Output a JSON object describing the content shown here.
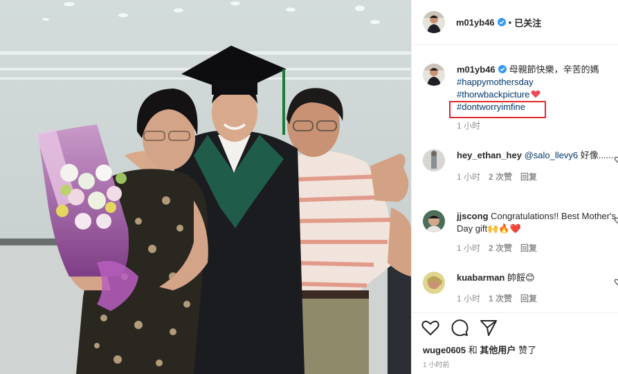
{
  "post": {
    "username": "m01yb46",
    "follow_label": "已关注",
    "dot": "•"
  },
  "caption": {
    "username": "m01yb46",
    "text": "母親節快樂，辛苦的媽",
    "hashtags": [
      "#happymothersday",
      "#thorwbackpicture",
      "#dontworryimfine"
    ],
    "time": "1 小时"
  },
  "comments": [
    {
      "username": "hey_ethan_hey",
      "text": "@salo_llevy6 好像......",
      "mention": "@salo_llevy6",
      "rest": " 好像......",
      "time": "1 小时",
      "likes": "2 次赞",
      "reply": "回复"
    },
    {
      "username": "jjscong",
      "text": "Congratulations!! Best Mother's Day gift🙌🔥❤️",
      "time": "1 小时",
      "likes": "2 次赞",
      "reply": "回复"
    },
    {
      "username": "kuabarman",
      "text": "帥餒😊",
      "time": "1 小时",
      "likes": "1 次赞",
      "reply": "回复"
    }
  ],
  "likes": {
    "user": "wuge0605",
    "and": "和",
    "others": "其他用户",
    "suffix": "赞了"
  },
  "post_time": "1 小时前",
  "colors": {
    "link": "#00376b",
    "verified": "#3897f0",
    "highlight_box": "#e0262c",
    "heart": "#ed4956"
  }
}
